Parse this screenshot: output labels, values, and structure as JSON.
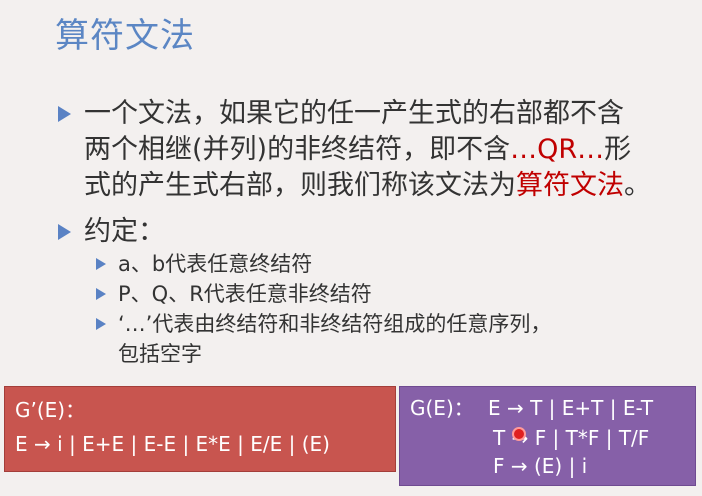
{
  "title": "算符文法",
  "para": {
    "line1": "一个文法，如果它的任一产生式的右部都不含",
    "line2a": "两个相继(并列)的非终结符，即不含",
    "line2b": "…QR…",
    "line2c": "形",
    "line3a": "式的产生式右部，则我们称该文法为",
    "line3b": "算符文法",
    "line3c": "。"
  },
  "convention": {
    "heading": "约定：",
    "items": [
      "a、b代表任意终结符",
      "P、Q、R代表任意非终结符",
      "‘…’代表由终结符和非终结符组成的任意序列，",
      "包括空字"
    ]
  },
  "grammar_g1": {
    "label": "G’(E)：",
    "rule": "E → i | E+E | E-E | E*E | E/E | (E)"
  },
  "grammar_g2": {
    "label": "G(E)：",
    "rules": [
      "E → T | E+T | E-T",
      "T → F | T*F | T/F",
      "F → (E) | i"
    ]
  },
  "colors": {
    "title": "#5b86c4",
    "highlight": "#c00000",
    "box_red": "#c8554f",
    "box_purple": "#8660a8"
  }
}
